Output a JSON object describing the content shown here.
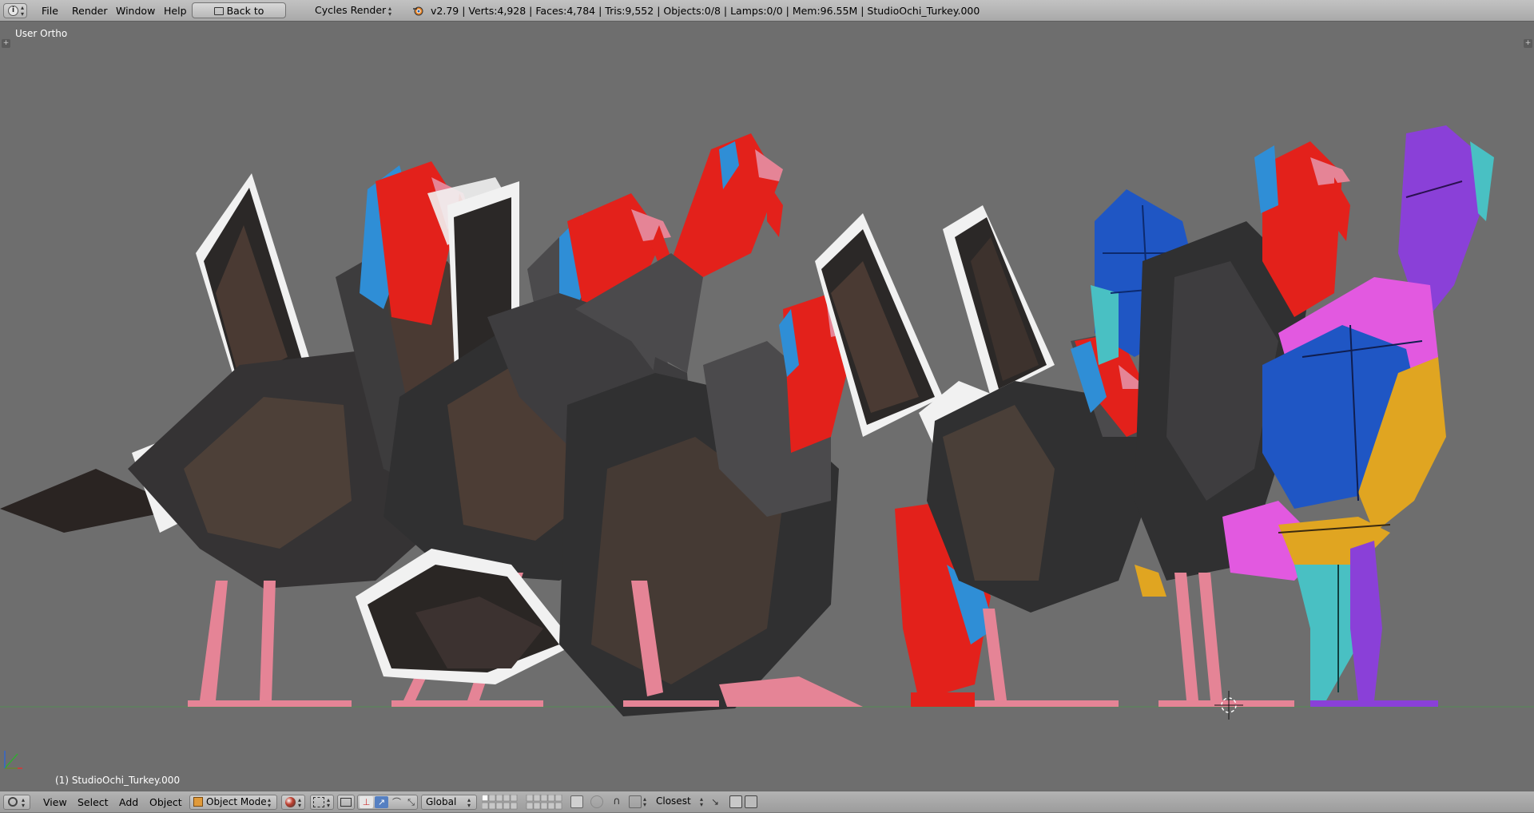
{
  "topbar": {
    "menus": [
      "File",
      "Render",
      "Window",
      "Help"
    ],
    "back_button": "Back to Previous",
    "render_engine": "Cycles Render",
    "stats": "v2.79 | Verts:4,928 | Faces:4,784 | Tris:9,552 | Objects:0/8 | Lamps:0/0 | Mem:96.55M | StudioOchi_Turkey.000"
  },
  "viewport": {
    "view_name": "User Ortho",
    "active_object": "(1) StudioOchi_Turkey.000"
  },
  "bottombar": {
    "menus": [
      "View",
      "Select",
      "Add",
      "Object"
    ],
    "mode": "Object Mode",
    "orientation": "Global",
    "snap_target": "Closest"
  },
  "colors": {
    "viewport_bg": "#6e6e6e",
    "header_bg": "#b5b5b5",
    "turkey_head": "#e3211b",
    "turkey_neck_blue": "#2f8ed6",
    "turkey_legs": "#e58496",
    "uv_purple": "#8a40d8",
    "uv_magenta": "#e259e0",
    "uv_blue": "#1f56c4",
    "uv_orange": "#e0a521",
    "uv_cyan": "#49c0c3"
  },
  "icons": {
    "editor_type": "info-icon",
    "blender_logo": "blender-logo-icon",
    "viewport_editor": "3d-view-icon",
    "object_mode": "cube-icon",
    "shading": "shading-sphere-icon",
    "pivot": "pivot-icon",
    "manipulator": "manipulator-icon",
    "layers": "layers-icon",
    "snap": "magnet-icon",
    "render": "render-camera-icon"
  }
}
